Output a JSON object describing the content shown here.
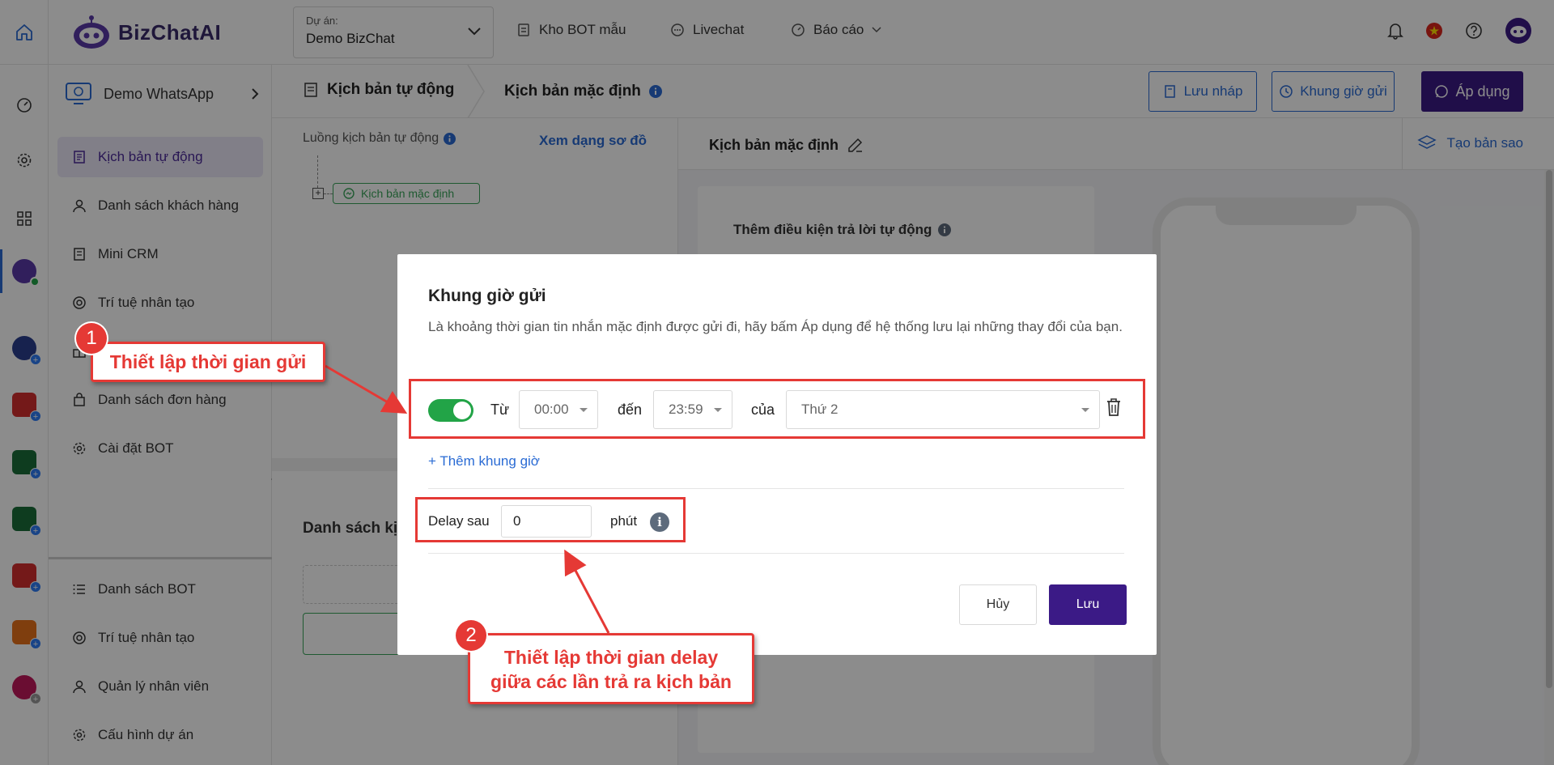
{
  "topbar": {
    "brand": "BizChatAI",
    "project_label": "Dự án:",
    "project_value": "Demo BizChat",
    "nav": [
      {
        "label": "Kho BOT mẫu",
        "icon": "bot-template-icon"
      },
      {
        "label": "Livechat",
        "icon": "chat-bubble-icon"
      },
      {
        "label": "Báo cáo",
        "icon": "dashboard-icon"
      }
    ]
  },
  "sidebar": {
    "bot_name": "Demo WhatsApp",
    "items": [
      {
        "label": "Kịch bản tự động",
        "icon": "script-icon"
      },
      {
        "label": "Danh sách khách hàng",
        "icon": "user-icon"
      },
      {
        "label": "Mini CRM",
        "icon": "crm-icon"
      },
      {
        "label": "Trí tuệ nhân tạo",
        "icon": "ai-icon"
      },
      {
        "label": "",
        "icon": "gift-icon"
      },
      {
        "label": "Danh sách đơn hàng",
        "icon": "bag-icon"
      },
      {
        "label": "Cài đặt BOT",
        "icon": "gear-icon"
      }
    ],
    "bottom_items": [
      {
        "label": "Danh sách BOT",
        "icon": "list-icon"
      },
      {
        "label": "Trí tuệ nhân tạo",
        "icon": "ai-icon"
      },
      {
        "label": "Quản lý nhân viên",
        "icon": "user-icon"
      },
      {
        "label": "Cấu hình dự án",
        "icon": "gear-icon"
      }
    ]
  },
  "breadcrumb": {
    "section": "Kịch bản tự động",
    "current": "Kịch bản mặc định"
  },
  "actions": {
    "draft": "Lưu nháp",
    "schedule": "Khung giờ gửi",
    "apply": "Áp dụng"
  },
  "left_panel": {
    "flow_title": "Luồng kịch bản tự động",
    "view_diagram": "Xem dạng sơ đồ",
    "node_label": "Kịch bản mặc định",
    "list_title": "Danh sách kị"
  },
  "right_panel": {
    "title": "Kịch bản mặc định",
    "duplicate": "Tạo bản sao",
    "condition_title": "Thêm điều kiện trả lời tự động"
  },
  "modal": {
    "title": "Khung giờ gửi",
    "description": "Là khoảng thời gian tin nhắn mặc định được gửi đi, hãy bấm Áp dụng để hệ thống lưu lại những thay đổi của bạn.",
    "slot": {
      "enabled": true,
      "from_label": "Từ",
      "from_value": "00:00",
      "to_label": "đến",
      "to_value": "23:59",
      "of_label": "của",
      "day_value": "Thứ 2"
    },
    "add_slot": "+ Thêm khung giờ",
    "delay_label": "Delay sau",
    "delay_value": "0",
    "delay_unit": "phút",
    "cancel": "Hủy",
    "save": "Lưu"
  },
  "annotations": [
    {
      "number": "1",
      "text": "Thiết lập thời gian gửi"
    },
    {
      "number": "2",
      "line1": "Thiết lập thời gian delay",
      "line2": "giữa các lần trả ra kịch bản"
    }
  ],
  "colors": {
    "primary": "#3b1a86",
    "link": "#2a6bd4",
    "success": "#22a447",
    "annotation": "#e53935"
  }
}
